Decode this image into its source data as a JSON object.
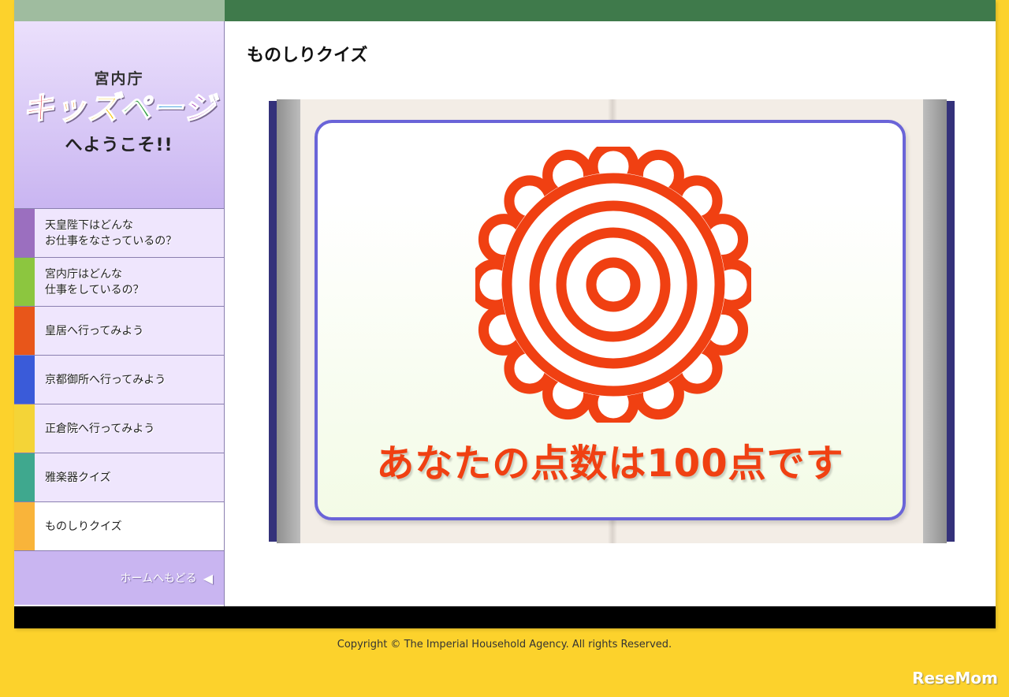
{
  "logo": {
    "line1": "宮内庁",
    "chars": [
      "キ",
      "ッ",
      "ズ",
      "ペ",
      "ー",
      "ジ"
    ],
    "line3": "へようこそ!!"
  },
  "nav": {
    "items": [
      {
        "label": "天皇陛下はどんな\nお仕事をなさっているの？",
        "color": "#9b6fbf"
      },
      {
        "label": "宮内庁はどんな\n仕事をしているの？",
        "color": "#8cc63f"
      },
      {
        "label": "皇居へ行ってみよう",
        "color": "#e8561a"
      },
      {
        "label": "京都御所へ行ってみよう",
        "color": "#3a5bd9"
      },
      {
        "label": "正倉院へ行ってみよう",
        "color": "#f4d437"
      },
      {
        "label": "雅楽器クイズ",
        "color": "#3fa88e"
      },
      {
        "label": "ものしりクイズ",
        "color": "#f9b43a",
        "active": true
      }
    ],
    "home_label": "ホームへもどる",
    "home_arrow": "🡐"
  },
  "main": {
    "title": "ものしりクイズ",
    "score_text": "あなたの点数は100点です",
    "stamp_color": "#f04012",
    "card_border_color": "#6a64d8"
  },
  "footer": {
    "copyright": "Copyright © The Imperial Household Agency. All rights Reserved."
  },
  "watermark": "ReseMom"
}
